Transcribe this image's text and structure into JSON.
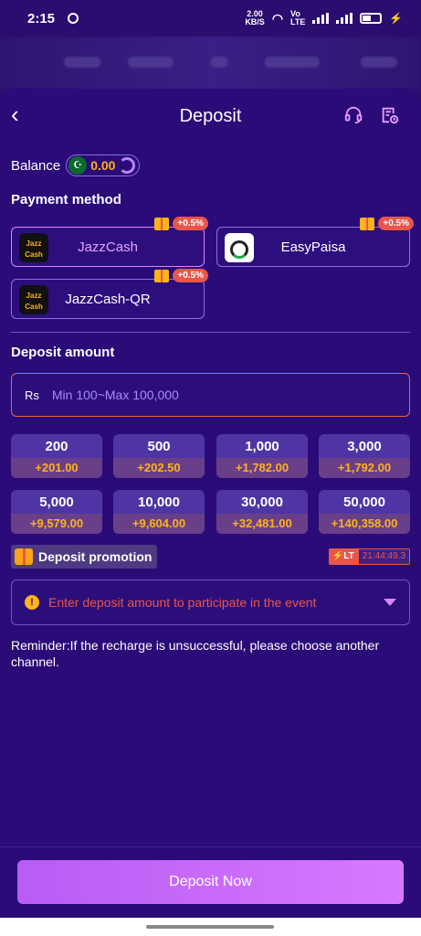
{
  "status": {
    "time": "2:15",
    "net_speed": "2.00",
    "net_unit": "KB/S",
    "volte": "Vo LTE"
  },
  "header": {
    "title": "Deposit"
  },
  "balance": {
    "label": "Balance",
    "value": "0.00"
  },
  "payment": {
    "title": "Payment method",
    "methods": [
      {
        "label": "JazzCash",
        "badge": "+0.5%",
        "selected": true
      },
      {
        "label": "EasyPaisa",
        "badge": "+0.5%",
        "selected": false
      },
      {
        "label": "JazzCash-QR",
        "badge": "+0.5%",
        "selected": false
      }
    ]
  },
  "deposit_amount": {
    "title": "Deposit amount",
    "currency": "Rs",
    "placeholder": "Min 100~Max 100,000",
    "presets": [
      {
        "amount": "200",
        "bonus": "+201.00"
      },
      {
        "amount": "500",
        "bonus": "+202.50"
      },
      {
        "amount": "1,000",
        "bonus": "+1,782.00"
      },
      {
        "amount": "3,000",
        "bonus": "+1,792.00"
      },
      {
        "amount": "5,000",
        "bonus": "+9,579.00"
      },
      {
        "amount": "10,000",
        "bonus": "+9,604.00"
      },
      {
        "amount": "30,000",
        "bonus": "+32,481.00"
      },
      {
        "amount": "50,000",
        "bonus": "+140,358.00"
      }
    ]
  },
  "promotion": {
    "label": "Deposit promotion",
    "timer_tag": "LT",
    "timer": "21:44:49.3",
    "event_text": "Enter deposit amount to participate in the event"
  },
  "reminder": "Reminder:If the recharge is unsuccessful, please choose another channel.",
  "cta": {
    "label": "Deposit Now"
  }
}
